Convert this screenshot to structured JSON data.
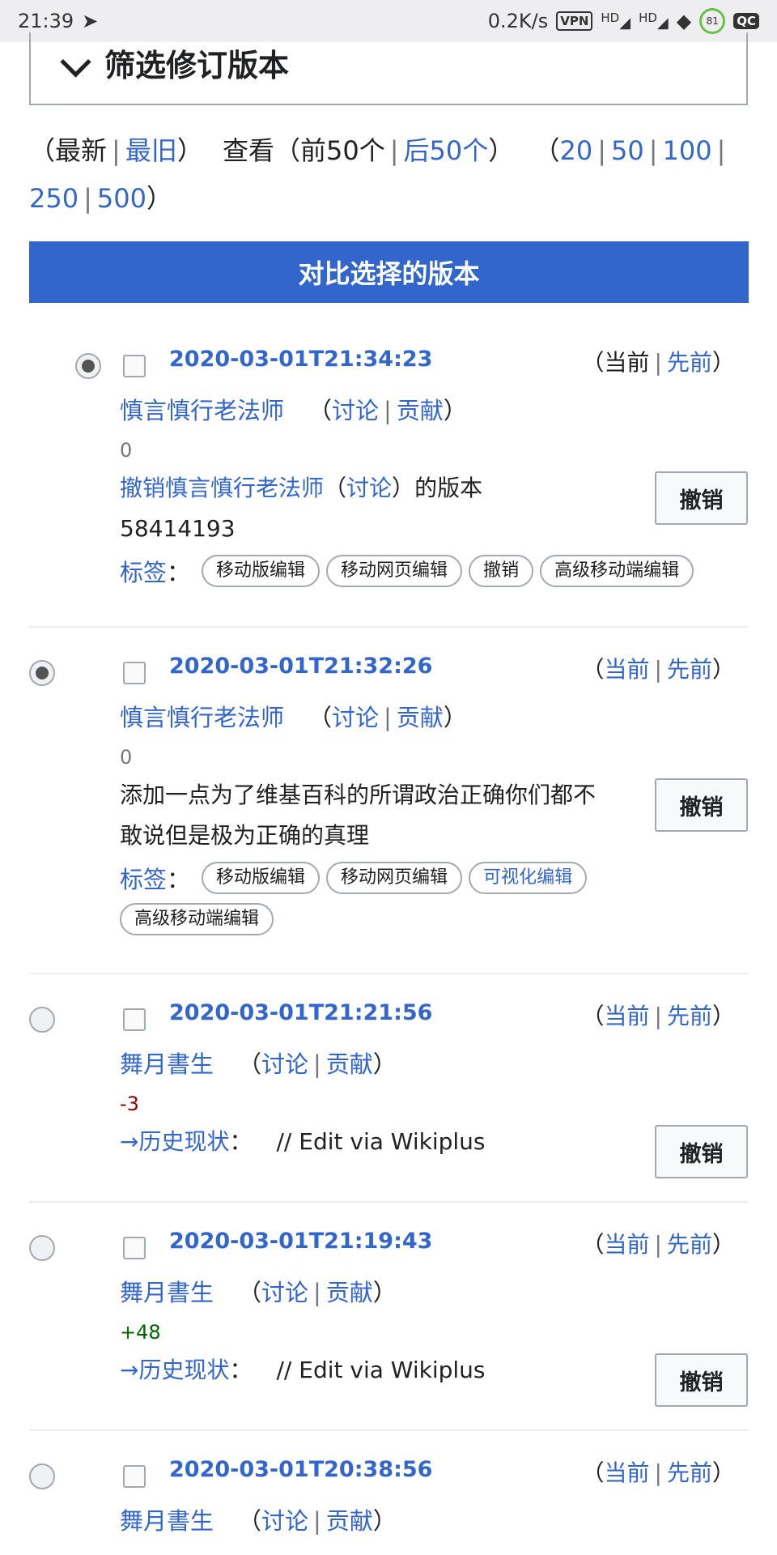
{
  "status_bar": {
    "time": "21:39",
    "speed": "0.2K/s",
    "vpn": "VPN",
    "hd1": "HD",
    "hd2": "HD",
    "battery": "81",
    "qc": "QC"
  },
  "filter": {
    "title": "筛选修订版本"
  },
  "nav": {
    "open_paren": "（",
    "latest": "最新",
    "oldest": "最旧",
    "close_paren": "）",
    "view": "查看（",
    "prev50": "前50个",
    "next50": "后50个",
    "close_view": "）",
    "open_limits": "（",
    "limits": [
      "20",
      "50",
      "100",
      "250",
      "500"
    ],
    "close_limits": "）"
  },
  "compare_button": "对比选择的版本",
  "revisions": [
    {
      "date": "2020-03-01T21:34:23",
      "current": "当前",
      "previous": "先前",
      "user": "慎言慎行老法师",
      "talk": "讨论",
      "contribs": "贡献",
      "size": "0",
      "summary_link": "撤销慎言慎行老法师",
      "summary_talk": "讨论",
      "summary_rest": "的版本",
      "summary_line2": "58414193",
      "undo": "撤销",
      "tags_label": "标签",
      "tags": [
        "移动版编辑",
        "移动网页编辑",
        "撤销",
        "高级移动端编辑"
      ]
    },
    {
      "date": "2020-03-01T21:32:26",
      "current": "当前",
      "previous": "先前",
      "user": "慎言慎行老法师",
      "talk": "讨论",
      "contribs": "贡献",
      "size": "0",
      "summary": "添加一点为了维基百科的所谓政治正确你们都不敢说但是极为正确的真理",
      "undo": "撤销",
      "tags_label": "标签",
      "tags": [
        "移动版编辑",
        "移动网页编辑",
        "可视化编辑",
        "高级移动端编辑"
      ]
    },
    {
      "date": "2020-03-01T21:21:56",
      "current": "当前",
      "previous": "先前",
      "user": "舞月書生",
      "talk": "讨论",
      "contribs": "贡献",
      "size": "-3",
      "section": "→历史现状",
      "comment": "// Edit via Wikiplus",
      "undo": "撤销"
    },
    {
      "date": "2020-03-01T21:19:43",
      "current": "当前",
      "previous": "先前",
      "user": "舞月書生",
      "talk": "讨论",
      "contribs": "贡献",
      "size": "+48",
      "section": "→历史现状",
      "comment": "// Edit via Wikiplus",
      "undo": "撤销"
    },
    {
      "date": "2020-03-01T20:38:56",
      "current": "当前",
      "previous": "先前",
      "user": "舞月書生",
      "talk": "讨论",
      "contribs": "贡献"
    }
  ]
}
